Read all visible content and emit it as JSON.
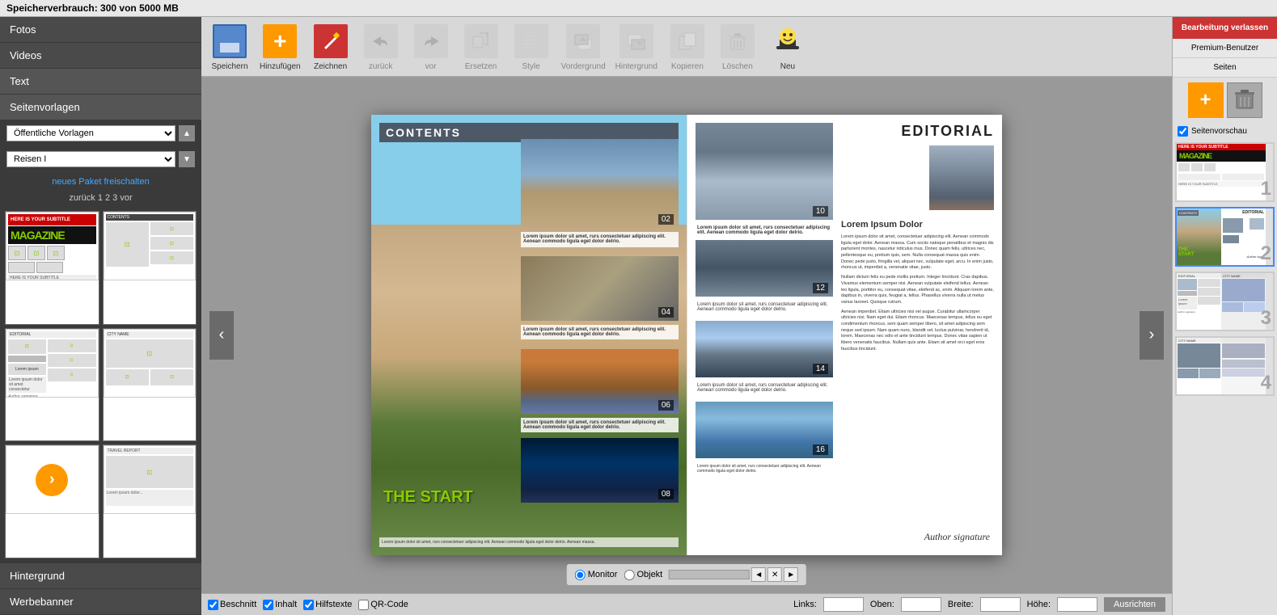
{
  "topbar": {
    "storage_label": "Speicherverbrauch: 300 von 5000 MB"
  },
  "toolbar": {
    "save_label": "Speichern",
    "add_label": "Hinzufügen",
    "draw_label": "Zeichnen",
    "back_label": "zurück",
    "forward_label": "vor",
    "replace_label": "Ersetzen",
    "style_label": "Style",
    "foreground_label": "Vordergrund",
    "background_label": "Hintergrund",
    "copy_label": "Kopieren",
    "delete_label": "Löschen",
    "new_label": "Neu"
  },
  "sidebar": {
    "photos_label": "Fotos",
    "videos_label": "Videos",
    "text_label": "Text",
    "page_templates_label": "Seitenvorlagen",
    "public_templates_label": "Öffentliche Vorlagen",
    "travel_template_label": "Reisen I",
    "new_packet_label": "neues Paket freischalten",
    "pagination": "zurück 1 2 3 vor",
    "background_label": "Hintergrund",
    "ad_banner_label": "Werbebanner"
  },
  "right_sidebar": {
    "preview_label": "Seitenvorschau",
    "exit_label": "Bearbeitung verlassen",
    "premium_label": "Premium-Benutzer",
    "pages_label": "Seiten",
    "page_numbers": [
      "1",
      "2",
      "3",
      "4"
    ]
  },
  "bottom_bar": {
    "monitor_label": "Monitor",
    "object_label": "Objekt",
    "trim_label": "Beschnitt",
    "content_label": "Inhalt",
    "help_text_label": "Hilfstexte",
    "qr_code_label": "QR-Code",
    "left_label": "Links:",
    "top_label": "Oben:",
    "width_label": "Breite:",
    "height_label": "Höhe:",
    "align_label": "Ausrichten"
  }
}
